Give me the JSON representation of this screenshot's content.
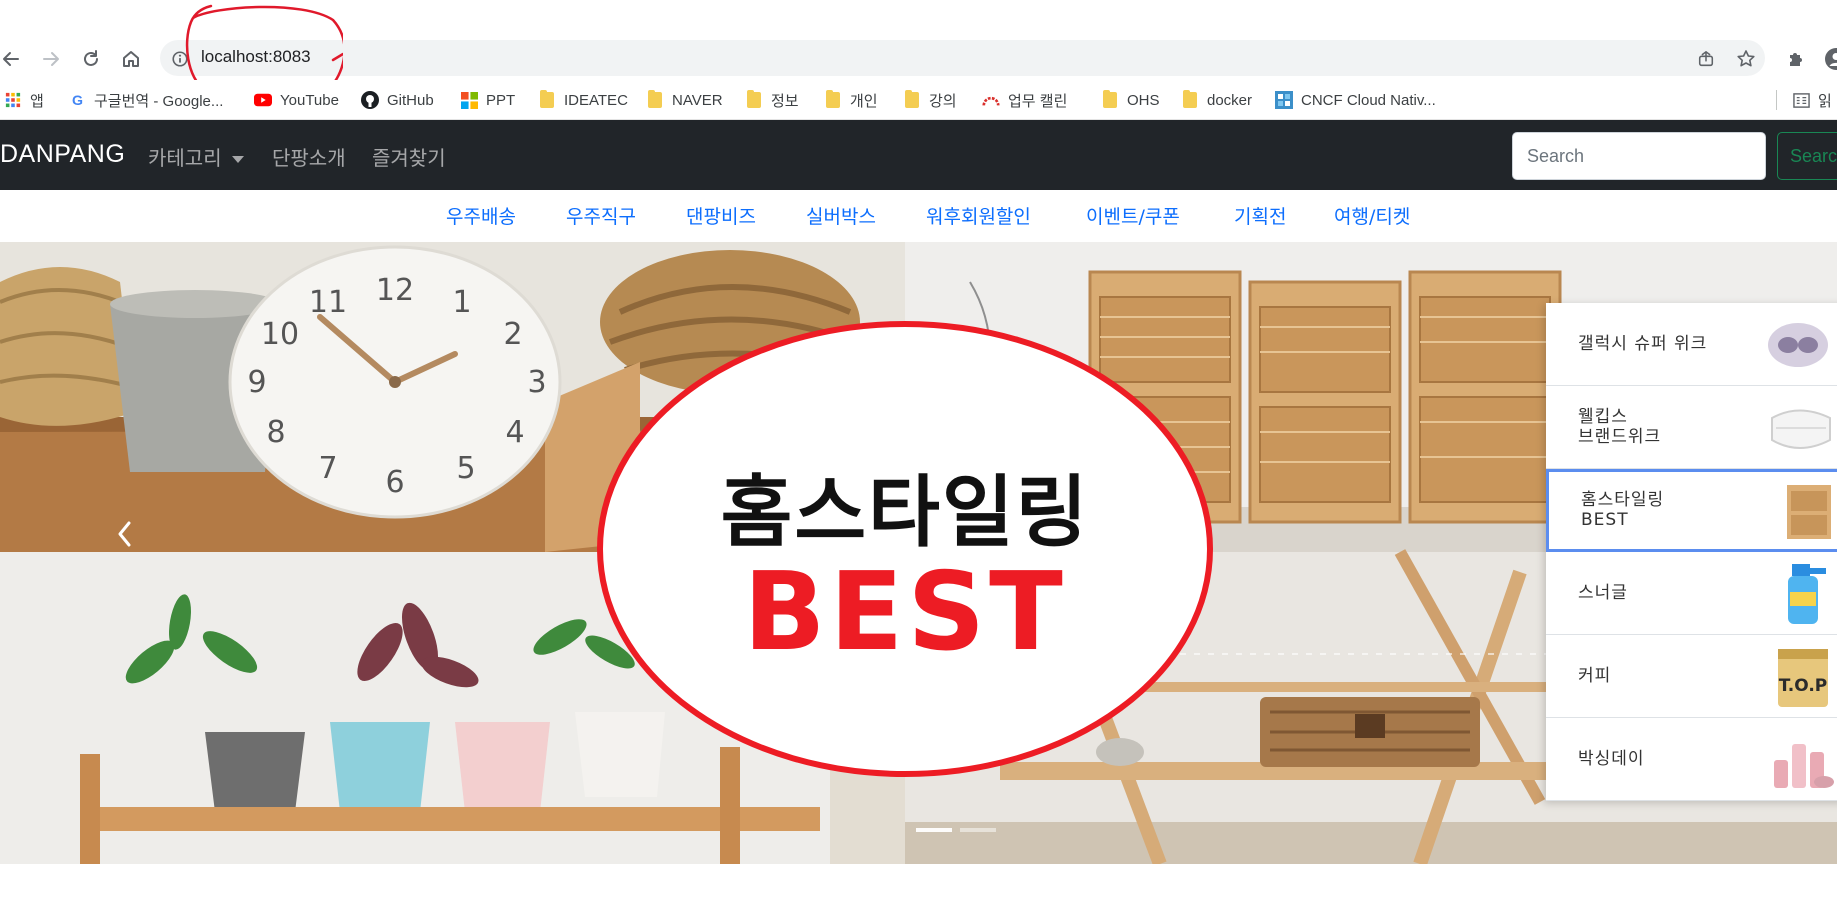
{
  "browser": {
    "url": "localhost:8083",
    "bookmarks": [
      {
        "label": "앱",
        "icon": "apps-grid-icon"
      },
      {
        "label": "구글번역 - Google...",
        "icon": "google-icon"
      },
      {
        "label": "YouTube",
        "icon": "youtube-icon"
      },
      {
        "label": "GitHub",
        "icon": "github-icon"
      },
      {
        "label": "PPT",
        "icon": "microsoft-icon"
      },
      {
        "label": "IDEATEC",
        "icon": "folder-icon"
      },
      {
        "label": "NAVER",
        "icon": "folder-icon"
      },
      {
        "label": "정보",
        "icon": "folder-icon"
      },
      {
        "label": "개인",
        "icon": "folder-icon"
      },
      {
        "label": "강의",
        "icon": "folder-icon"
      },
      {
        "label": "업무 캘린",
        "icon": "calendar-arch-icon"
      },
      {
        "label": "OHS",
        "icon": "folder-icon"
      },
      {
        "label": "docker",
        "icon": "folder-icon"
      },
      {
        "label": "CNCF Cloud Nativ...",
        "icon": "cncf-icon"
      },
      {
        "label": "읽",
        "icon": "reading-list-icon"
      }
    ]
  },
  "navbar": {
    "brand": "DANPANG",
    "links": [
      "카테고리",
      "단팡소개",
      "즐겨찾기"
    ],
    "search_placeholder": "Search",
    "search_button": "Search"
  },
  "categories": [
    "우주배송",
    "우주직구",
    "댄팡비즈",
    "실버박스",
    "워후회원할인",
    "이벤트/쿠폰",
    "기획전",
    "여행/티켓"
  ],
  "hero": {
    "line1": "홈스타일링",
    "line2": "BEST",
    "clock_numbers": [
      "12",
      "1",
      "2",
      "3",
      "4",
      "5",
      "6",
      "7",
      "8",
      "9",
      "10",
      "11"
    ],
    "slide_count": 2,
    "active_slide": 1
  },
  "side_list": {
    "active_index": 2,
    "items": [
      {
        "label": "갤럭시 슈퍼 위크",
        "thumb": "earbuds-thumb"
      },
      {
        "label": "웰킵스\n브랜드위크",
        "thumb": "mask-thumb"
      },
      {
        "label": "홈스타일링\nBEST",
        "thumb": "cabinet-thumb"
      },
      {
        "label": "스너글",
        "thumb": "spray-bottle-thumb"
      },
      {
        "label": "커피",
        "thumb": "coffee-can-thumb"
      },
      {
        "label": "박싱데이",
        "thumb": "cosmetics-thumb"
      }
    ]
  },
  "colors": {
    "navbar_bg": "#212529",
    "link_blue": "#0d6efd",
    "success_green": "#198754",
    "best_red": "#ed1c24",
    "active_outline": "#5b8def",
    "annotation_red": "#e0192b"
  }
}
